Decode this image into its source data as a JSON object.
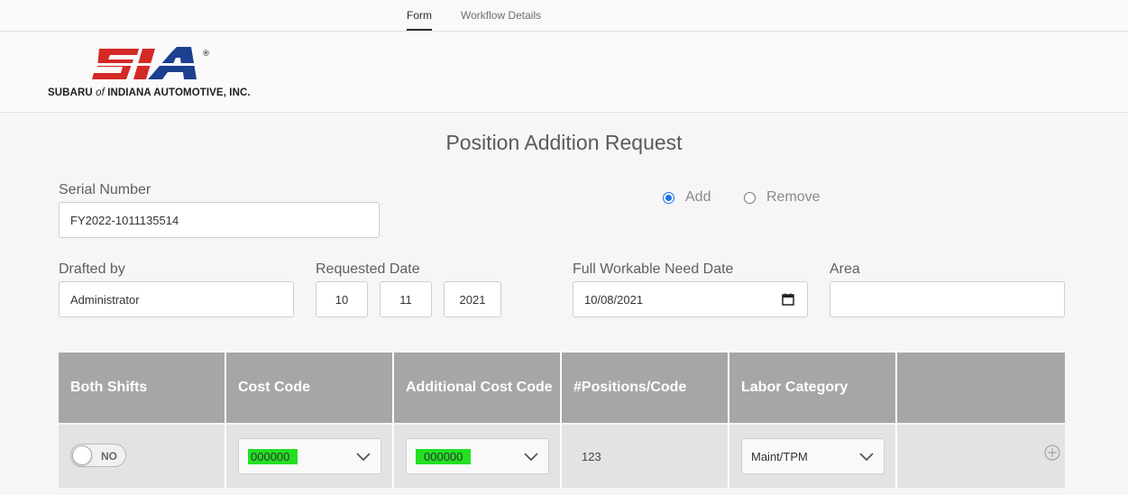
{
  "tabs": [
    {
      "label": "Form",
      "active": true
    },
    {
      "label": "Workflow Details",
      "active": false
    }
  ],
  "company": {
    "name_prefix": "SUBARU",
    "name_of": "of",
    "name_suffix": "INDIANA AUTOMOTIVE, INC.",
    "brand_colors": {
      "red": "#d42a26",
      "blue": "#1c3f8f"
    }
  },
  "form": {
    "title": "Position Addition Request",
    "serial_number": {
      "label": "Serial Number",
      "value": "FY2022-1011135514"
    },
    "action": {
      "options": [
        "Add",
        "Remove"
      ],
      "selected": "Add"
    },
    "drafted_by": {
      "label": "Drafted by",
      "value": "Administrator"
    },
    "requested_date": {
      "label": "Requested Date",
      "month": "10",
      "day": "11",
      "year": "2021"
    },
    "full_workable_need_date": {
      "label": "Full Workable Need Date",
      "value": "10/08/2021"
    },
    "area": {
      "label": "Area",
      "value": ""
    }
  },
  "table": {
    "headers": [
      "Both Shifts",
      "Cost Code",
      "Additional Cost Code",
      "#Positions/Code",
      "Labor Category",
      ""
    ],
    "row": {
      "both_shifts": "NO",
      "cost_code": "000000",
      "additional_cost_code": "000000",
      "positions": "123",
      "labor_category": "Maint/TPM"
    }
  },
  "colors": {
    "accent": "#1a73e8",
    "header_bg": "#a6a6a6",
    "highlight": "#22e022"
  }
}
